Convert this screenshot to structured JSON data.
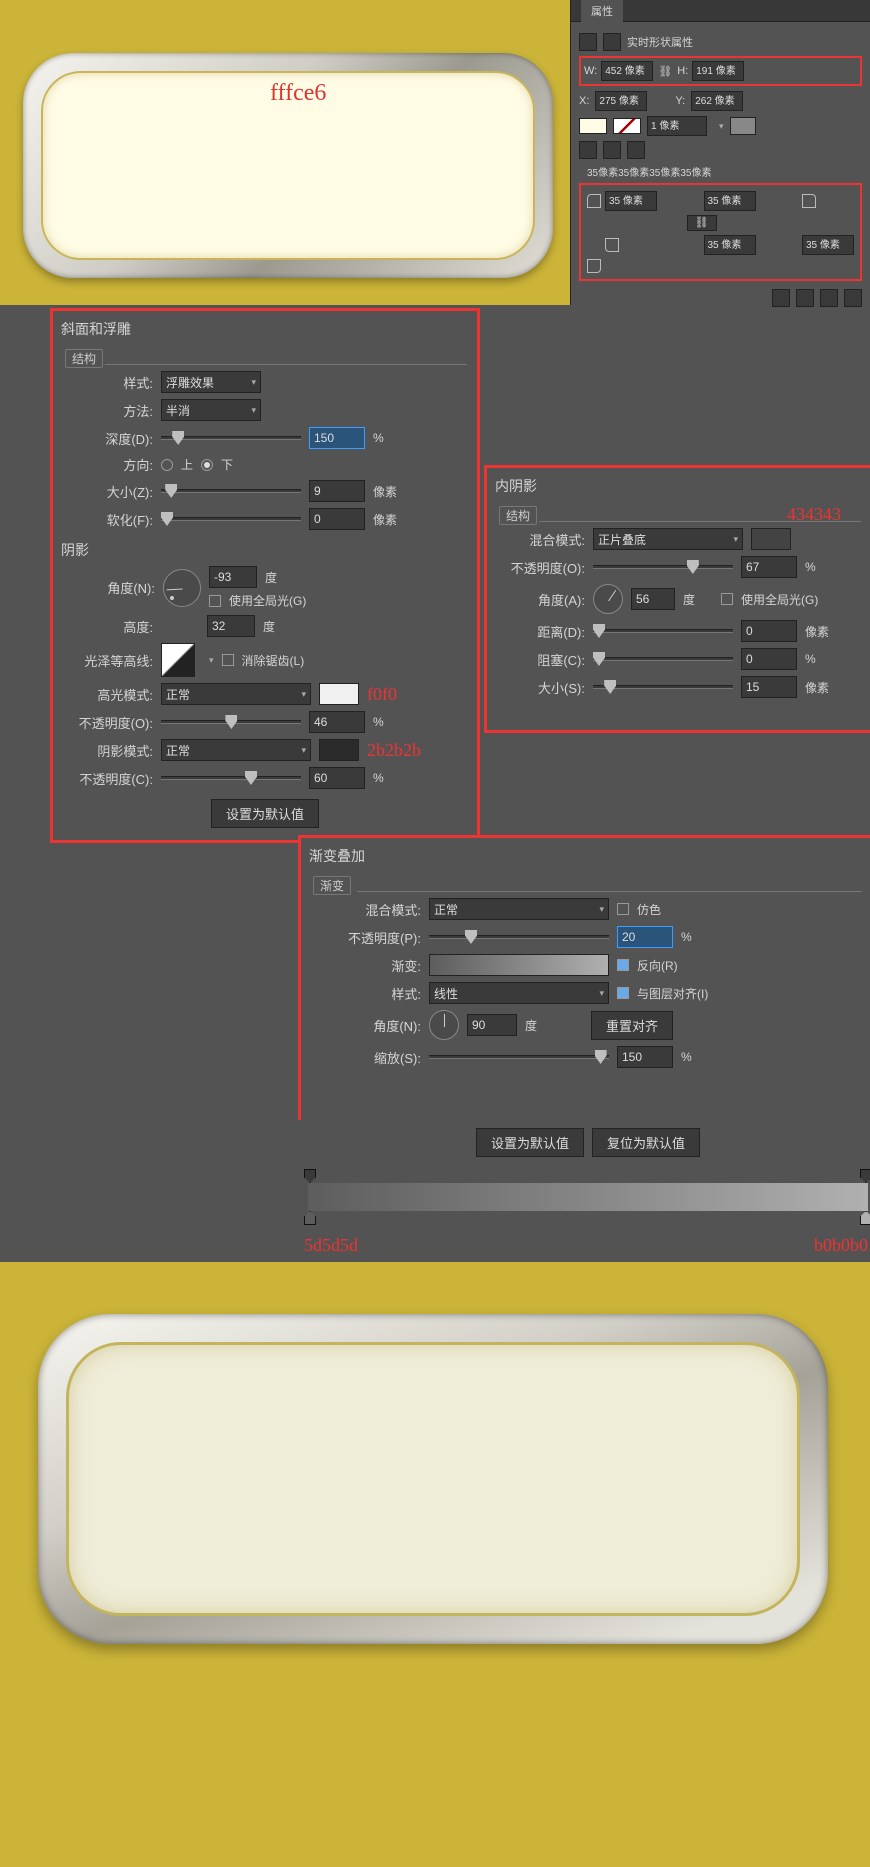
{
  "colors": {
    "fill_hex": "fffce6",
    "highlight_hex": "f0f0",
    "shadow_hex": "2b2b2b",
    "inner_shadow_hex": "434343",
    "grad_left_hex": "5d5d5d",
    "grad_right_hex": "b0b0b0"
  },
  "properties_panel": {
    "tab": "属性",
    "title": "实时形状属性",
    "W_label": "W:",
    "W_value": "452 像素",
    "H_label": "H:",
    "H_value": "191 像素",
    "X_label": "X:",
    "X_value": "275 像素",
    "Y_label": "Y:",
    "Y_value": "262 像素",
    "stroke_width": "1 像素",
    "corner_header": "35像素35像素35像素35像素",
    "corner_tl": "35 像素",
    "corner_tr": "35 像素",
    "corner_bl": "35 像素",
    "corner_br": "35 像素"
  },
  "bevel": {
    "title": "斜面和浮雕",
    "structure_label": "结构",
    "style_label": "样式:",
    "style_value": "浮雕效果",
    "technique_label": "方法:",
    "technique_value": "半消",
    "depth_label": "深度(D):",
    "depth_value": "150",
    "depth_unit": "%",
    "direction_label": "方向:",
    "dir_up": "上",
    "dir_down": "下",
    "size_label": "大小(Z):",
    "size_value": "9",
    "size_unit": "像素",
    "soften_label": "软化(F):",
    "soften_value": "0",
    "soften_unit": "像素",
    "shading_title": "阴影",
    "angle_label": "角度(N):",
    "angle_value": "-93",
    "angle_unit": "度",
    "use_global": "使用全局光(G)",
    "altitude_label": "高度:",
    "altitude_value": "32",
    "altitude_unit": "度",
    "gloss_label": "光泽等高线:",
    "antialias": "消除锯齿(L)",
    "highlight_mode_label": "高光模式:",
    "highlight_mode_value": "正常",
    "highlight_opacity_label": "不透明度(O):",
    "highlight_opacity_value": "46",
    "pct": "%",
    "shadow_mode_label": "阴影模式:",
    "shadow_mode_value": "正常",
    "shadow_opacity_label": "不透明度(C):",
    "shadow_opacity_value": "60",
    "make_default": "设置为默认值"
  },
  "inner_shadow": {
    "title": "内阴影",
    "structure_label": "结构",
    "blend_label": "混合模式:",
    "blend_value": "正片叠底",
    "opacity_label": "不透明度(O):",
    "opacity_value": "67",
    "pct": "%",
    "angle_label": "角度(A):",
    "angle_value": "56",
    "angle_unit": "度",
    "use_global": "使用全局光(G)",
    "distance_label": "距离(D):",
    "distance_value": "0",
    "distance_unit": "像素",
    "choke_label": "阻塞(C):",
    "choke_value": "0",
    "choke_unit": "%",
    "size_label": "大小(S):",
    "size_value": "15",
    "size_unit": "像素"
  },
  "gradient": {
    "title": "渐变叠加",
    "group_label": "渐变",
    "blend_label": "混合模式:",
    "blend_value": "正常",
    "dither": "仿色",
    "opacity_label": "不透明度(P):",
    "opacity_value": "20",
    "pct": "%",
    "gradient_label": "渐变:",
    "reverse": "反向(R)",
    "style_label": "样式:",
    "style_value": "线性",
    "align": "与图层对齐(I)",
    "angle_label": "角度(N):",
    "angle_value": "90",
    "angle_unit": "度",
    "reset_align": "重置对齐",
    "scale_label": "缩放(S):",
    "scale_value": "150",
    "make_default": "设置为默认值",
    "reset_default": "复位为默认值"
  }
}
